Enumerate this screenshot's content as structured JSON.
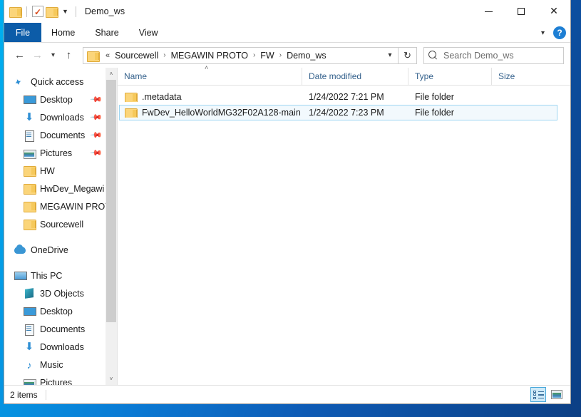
{
  "window": {
    "title": "Demo_ws",
    "quick_access_icons": [
      "folder-icon",
      "properties-icon",
      "new-folder-icon",
      "customize-chevron-icon"
    ],
    "controls": {
      "minimize": "—",
      "maximize": "□",
      "close": "✕"
    }
  },
  "ribbon": {
    "tabs": [
      {
        "label": "File",
        "active": true
      },
      {
        "label": "Home",
        "active": false
      },
      {
        "label": "Share",
        "active": false
      },
      {
        "label": "View",
        "active": false
      }
    ],
    "expand_chevron": "ˇ",
    "help_label": "?"
  },
  "address_bar": {
    "back": "←",
    "forward": "→",
    "recent_chevron": "ˇ",
    "up": "↑",
    "breadcrumb_overflow": "«",
    "breadcrumbs": [
      "Sourcewell",
      "MEGAWIN PROTO",
      "FW",
      "Demo_ws"
    ],
    "separator": "›",
    "dropdown_chevron": "ˇ",
    "refresh": "↻"
  },
  "search": {
    "placeholder": "Search Demo_ws",
    "icon": "search-icon"
  },
  "sidebar": {
    "scroll": {
      "up_arrow": "˄",
      "down_arrow": "˅"
    },
    "groups": [
      {
        "root": {
          "label": "Quick access",
          "icon": "pin-star-icon"
        },
        "items": [
          {
            "label": "Desktop",
            "icon": "desktop-icon",
            "pinned": true
          },
          {
            "label": "Downloads",
            "icon": "downloads-icon",
            "pinned": true
          },
          {
            "label": "Documents",
            "icon": "documents-icon",
            "pinned": true
          },
          {
            "label": "Pictures",
            "icon": "pictures-icon",
            "pinned": true
          },
          {
            "label": "HW",
            "icon": "folder-icon",
            "pinned": false
          },
          {
            "label": "HwDev_Megawi",
            "icon": "folder-icon",
            "pinned": false
          },
          {
            "label": "MEGAWIN PROT",
            "icon": "folder-icon",
            "pinned": false
          },
          {
            "label": "Sourcewell",
            "icon": "folder-icon",
            "pinned": false
          }
        ]
      },
      {
        "root": {
          "label": "OneDrive",
          "icon": "onedrive-cloud-icon"
        },
        "items": []
      },
      {
        "root": {
          "label": "This PC",
          "icon": "this-pc-icon"
        },
        "items": [
          {
            "label": "3D Objects",
            "icon": "3d-objects-icon",
            "pinned": false
          },
          {
            "label": "Desktop",
            "icon": "desktop-icon",
            "pinned": false
          },
          {
            "label": "Documents",
            "icon": "documents-icon",
            "pinned": false
          },
          {
            "label": "Downloads",
            "icon": "downloads-icon",
            "pinned": false
          },
          {
            "label": "Music",
            "icon": "music-icon",
            "pinned": false
          },
          {
            "label": "Pictures",
            "icon": "pictures-icon",
            "pinned": false
          }
        ]
      }
    ]
  },
  "file_list": {
    "columns": [
      {
        "label": "Name",
        "sorted": "asc",
        "sort_caret": "˄"
      },
      {
        "label": "Date modified",
        "sorted": ""
      },
      {
        "label": "Type",
        "sorted": ""
      },
      {
        "label": "Size",
        "sorted": ""
      }
    ],
    "rows": [
      {
        "icon": "folder-icon",
        "name": ".metadata",
        "date_modified": "1/24/2022 7:21 PM",
        "type": "File folder",
        "size": "",
        "selected": false
      },
      {
        "icon": "folder-icon",
        "name": "FwDev_HelloWorldMG32F02A128-main",
        "date_modified": "1/24/2022 7:23 PM",
        "type": "File folder",
        "size": "",
        "selected": true
      }
    ]
  },
  "status_bar": {
    "item_count": "2 items",
    "views": [
      {
        "name": "details-view",
        "active": true
      },
      {
        "name": "large-icons-view",
        "active": false
      }
    ]
  },
  "colors": {
    "accent": "#0c5ca8",
    "selection_fill": "#f2f9fd",
    "selection_border": "#9fd6f2",
    "folder_yellow": "#fbd57a",
    "column_header_text": "#34618c",
    "desktop_gradient_start": "#00b0f0",
    "desktop_gradient_end": "#0c3f84"
  }
}
